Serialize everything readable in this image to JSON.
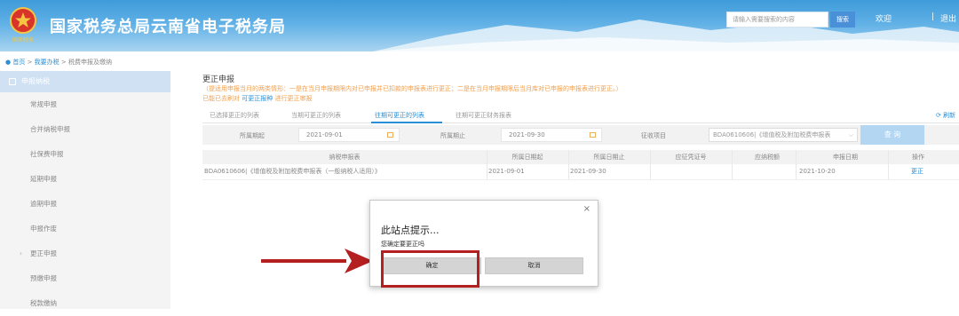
{
  "header": {
    "site_title": "国家税务总局云南省电子税务局",
    "emblem_text": "国家税务",
    "search_placeholder": "请输入需要搜索的内容",
    "search_button": "搜索",
    "welcome": "欢迎",
    "separator": "|",
    "logout": "退出"
  },
  "breadcrumb": {
    "home": "首页",
    "sep1": " > ",
    "level1": "我要办税",
    "sep2": " > ",
    "level2": "税费申报及缴纳"
  },
  "sidebar": {
    "active_label": "申报纳税",
    "items": [
      {
        "label": "常规申报"
      },
      {
        "label": "合并纳税申报"
      },
      {
        "label": "社保费申报"
      },
      {
        "label": "延期申报"
      },
      {
        "label": "逾期申报"
      },
      {
        "label": "申报作废"
      },
      {
        "label": "更正申报"
      },
      {
        "label": "预缴申报"
      },
      {
        "label": "税款缴纳"
      }
    ]
  },
  "main": {
    "title": "更正申报",
    "notice_line1": "（提适用申报当月的两类情形：一是在当月申报期限内对已申报并已扣款的申报表进行更正；二是在当月申报期限后当月库对已申报的申报表进行更正。）",
    "notice_line2_prefix": "已能已去刷对",
    "notice_line2_link": "可更正报种",
    "notice_line2_suffix": "进行更正审报",
    "tabs": [
      "已选择更正的列表",
      "当期可更正的列表",
      "往期可更正的列表",
      "往期可更正财务报表"
    ],
    "active_tab_index": 2,
    "refresh_label": "刷新"
  },
  "filter": {
    "period_start_label": "所属期起",
    "period_start_value": "2021-09-01",
    "period_end_label": "所属期止",
    "period_end_value": "2021-09-30",
    "levy_item_label": "征收项目",
    "levy_item_value": "BDA0610606|《增值税及附加税费申报表",
    "query_button": "查 询"
  },
  "table": {
    "headers": [
      "纳税申报表",
      "所属日期起",
      "所属日期止",
      "应征凭证号",
      "应纳税额",
      "申报日期",
      "操作"
    ],
    "rows": [
      {
        "form": "BDA0610606|《增值税及附加税费申报表（一般纳税人适用）》",
        "start": "2021-09-01",
        "end": "2021-09-30",
        "voucher": "",
        "tax_amount": "",
        "declare_date": "2021-10-20",
        "action": "更正"
      }
    ]
  },
  "dialog": {
    "close": "×",
    "title": "此站点提示...",
    "message": "您确定要更正吗",
    "ok_button": "确定",
    "cancel_button": "取消"
  },
  "colors": {
    "header_blue": "#3f9bd9",
    "link_blue": "#2a8fd6",
    "notice_orange": "#f0a050",
    "highlight_red": "#b41f1f",
    "sidebar_active": "#cfe1f2",
    "query_button": "#b3d6f3"
  }
}
